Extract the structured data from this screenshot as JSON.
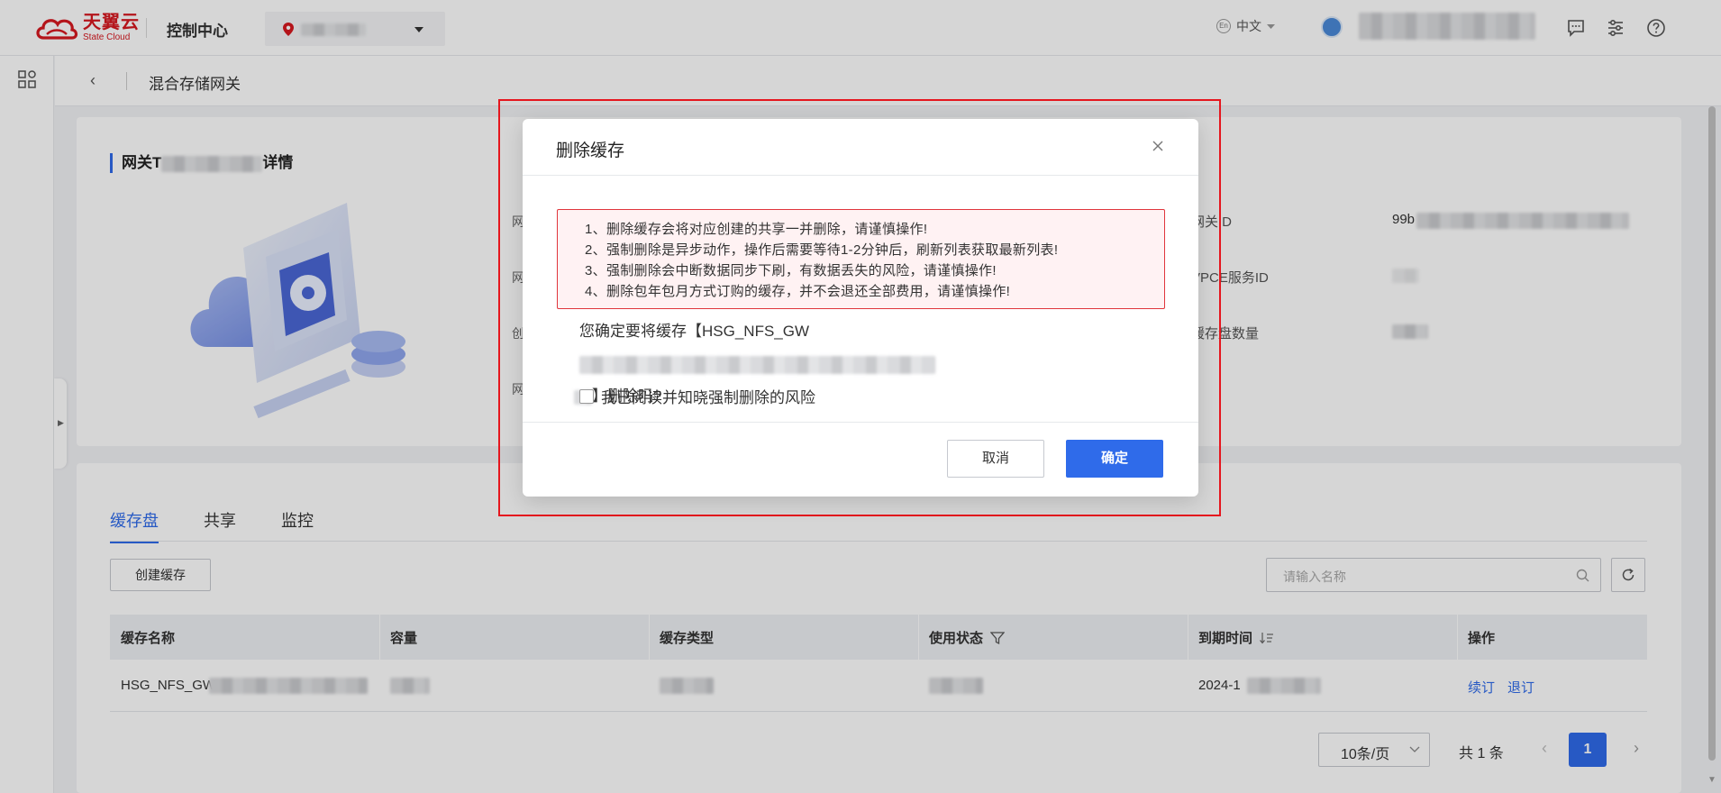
{
  "topbar": {
    "logo_cn": "天翼云",
    "logo_en": "State Cloud",
    "console_title": "控制中心",
    "language": "中文",
    "language_badge": "En"
  },
  "breadcrumb": {
    "title": "混合存储网关"
  },
  "detail": {
    "title_prefix": "网关T",
    "title_suffix": "详情",
    "left_fragments": [
      "网",
      "网",
      "创",
      "网"
    ],
    "fields": [
      {
        "label": "网关ID",
        "value": "99b"
      },
      {
        "label": "VPCE服务ID",
        "value": ""
      },
      {
        "label": "缓存盘数量",
        "value": ""
      }
    ]
  },
  "tabs": [
    {
      "label": "缓存盘",
      "active": true
    },
    {
      "label": "共享",
      "active": false
    },
    {
      "label": "监控",
      "active": false
    }
  ],
  "toolbar": {
    "create_label": "创建缓存",
    "search_placeholder": "请输入名称"
  },
  "table": {
    "headers": [
      "缓存名称",
      "容量",
      "缓存类型",
      "使用状态",
      "到期时间",
      "操作"
    ],
    "rows": [
      {
        "name_prefix": "HSG_NFS_GW",
        "expire_prefix": "2024-1",
        "actions": [
          "续订",
          "退订"
        ]
      }
    ]
  },
  "pagination": {
    "page_size": "10条/页",
    "total": "共 1 条",
    "current_page": "1"
  },
  "modal": {
    "title": "删除缓存",
    "warnings": [
      "1、删除缓存会将对应创建的共享一并删除，请谨慎操作!",
      "2、强制删除是异步动作，操作后需要等待1-2分钟后，刷新列表获取最新列表!",
      "3、强制删除会中断数据同步下刷，有数据丢失的风险，请谨慎操作!",
      "4、删除包年包月方式订购的缓存，并不会退还全部费用，请谨慎操作!"
    ],
    "confirm_prefix": "您确定要将缓存【HSG_NFS_GW",
    "confirm_suffix": "】删除吗?",
    "risk_checkbox_label": "我已阅读并知晓强制删除的风险",
    "risk_checked": false,
    "cancel_label": "取消",
    "ok_label": "确定"
  },
  "colors": {
    "brand_red": "#d71920",
    "primary_blue": "#2f6bea",
    "warning_border": "#e0363c",
    "warning_bg": "#fff2f3",
    "highlight_box": "#e5161e"
  }
}
